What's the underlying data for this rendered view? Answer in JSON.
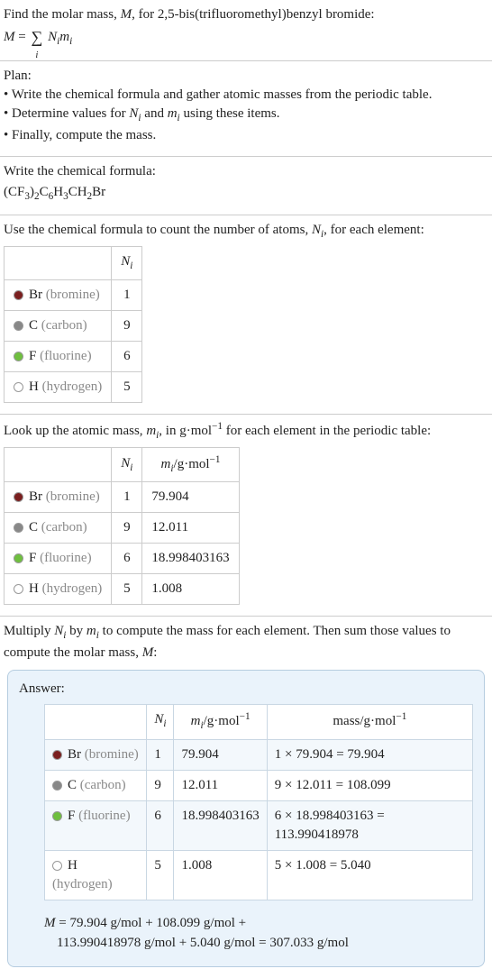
{
  "intro": {
    "line1_prefix": "Find the molar mass, ",
    "line1_m": "M",
    "line1_mid": ", for 2,5-bis(trifluoromethyl)benzyl bromide:",
    "eq_lhs": "M",
    "eq_eq": " = ",
    "eq_sigma": "∑",
    "eq_sigma_sub": "i",
    "eq_rhs1": "N",
    "eq_rhs1_sub": "i",
    "eq_rhs2": "m",
    "eq_rhs2_sub": "i"
  },
  "plan": {
    "title": "Plan:",
    "b1": "• Write the chemical formula and gather atomic masses from the periodic table.",
    "b2_prefix": "• Determine values for ",
    "b2_n": "N",
    "b2_nsub": "i",
    "b2_and": " and ",
    "b2_m": "m",
    "b2_msub": "i",
    "b2_suffix": " using these items.",
    "b3": "• Finally, compute the mass."
  },
  "formula": {
    "title": "Write the chemical formula:",
    "p1": "(CF",
    "s1": "3",
    "p2": ")",
    "s2": "2",
    "p3": "C",
    "s3": "6",
    "p4": "H",
    "s4": "3",
    "p5": "CH",
    "s5": "2",
    "p6": "Br"
  },
  "count": {
    "line_prefix": "Use the chemical formula to count the number of atoms, ",
    "n": "N",
    "nsub": "i",
    "line_suffix": ", for each element:",
    "col_N": "N",
    "col_N_sub": "i"
  },
  "elements": [
    {
      "dot": "br",
      "sym": "Br",
      "name": " (bromine)",
      "N": "1",
      "m": "79.904",
      "mass": "1 × 79.904 = 79.904"
    },
    {
      "dot": "c",
      "sym": "C",
      "name": " (carbon)",
      "N": "9",
      "m": "12.011",
      "mass": "9 × 12.011 = 108.099"
    },
    {
      "dot": "f",
      "sym": "F",
      "name": " (fluorine)",
      "N": "6",
      "m": "18.998403163",
      "mass": "6 × 18.998403163 = 113.990418978"
    },
    {
      "dot": "h",
      "sym": "H",
      "name": " (hydrogen)",
      "N": "5",
      "m": "1.008",
      "mass": "5 × 1.008 = 5.040"
    }
  ],
  "masses": {
    "line_prefix": "Look up the atomic mass, ",
    "m": "m",
    "msub": "i",
    "mid": ", in g·mol",
    "exp": "−1",
    "suffix": " for each element in the periodic table:",
    "col_m_pre": "m",
    "col_m_sub": "i",
    "col_m_mid": "/g·mol",
    "col_m_exp": "−1"
  },
  "multiply": {
    "prefix": "Multiply ",
    "n": "N",
    "nsub": "i",
    "by": " by ",
    "m": "m",
    "msub": "i",
    "mid": " to compute the mass for each element. Then sum those values to compute the molar mass, ",
    "Mvar": "M",
    "suffix": ":"
  },
  "answer": {
    "title": "Answer:",
    "col_mass_pre": "mass/g·mol",
    "col_mass_exp": "−1",
    "calc_line1": "M = 79.904 g/mol + 108.099 g/mol +",
    "calc_line2": "113.990418978 g/mol + 5.040 g/mol = 307.033 g/mol",
    "M": "M"
  }
}
